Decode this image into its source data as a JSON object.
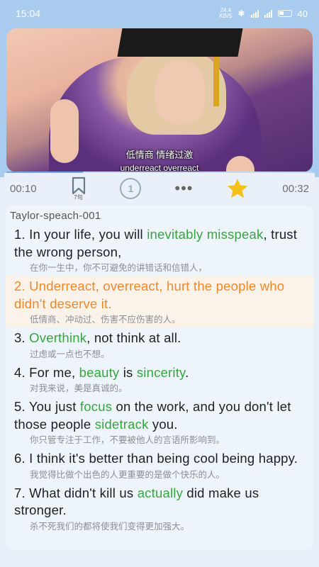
{
  "status": {
    "time": "15:04",
    "speed_value": "24.4",
    "speed_unit": "KB/S",
    "bluetooth": "✱",
    "battery": "40"
  },
  "video": {
    "subtitle_zh": "低情商 情绪过激",
    "subtitle_en": "underreact overreact",
    "progress": 0.25
  },
  "controls": {
    "current_time": "00:10",
    "total_time": "00:32",
    "bookmark_count": "7句",
    "replay_label": "1",
    "more": "•••",
    "favorite_color": "#f3c21a"
  },
  "lesson": {
    "title": "Taylor-speach-001",
    "sentences": [
      {
        "segments": [
          {
            "text": "1. In your life, you will ",
            "kw": false
          },
          {
            "text": "inevitably",
            "kw": true
          },
          {
            "text": " ",
            "kw": false
          },
          {
            "text": "misspeak",
            "kw": true
          },
          {
            "text": ", trust the wrong person,",
            "kw": false
          }
        ],
        "zh": "在你一生中，你不可避免的讲错话和信错人，",
        "active": false
      },
      {
        "segments": [
          {
            "text": "2. Underreact, overreact, hurt the people who didn't deserve it.",
            "kw": false
          }
        ],
        "zh": "低情商、冲动过、伤害不应伤害的人。",
        "active": true
      },
      {
        "segments": [
          {
            "text": "3. ",
            "kw": false
          },
          {
            "text": "Overthink",
            "kw": true
          },
          {
            "text": ", not think at all.",
            "kw": false
          }
        ],
        "zh": "过虑或一点也不想。",
        "active": false
      },
      {
        "segments": [
          {
            "text": "4. For me, ",
            "kw": false
          },
          {
            "text": "beauty",
            "kw": true
          },
          {
            "text": " is ",
            "kw": false
          },
          {
            "text": "sincerity",
            "kw": true
          },
          {
            "text": ".",
            "kw": false
          }
        ],
        "zh": "对我来说，美是真诚的。",
        "active": false
      },
      {
        "segments": [
          {
            "text": "5. You just ",
            "kw": false
          },
          {
            "text": "focus",
            "kw": true
          },
          {
            "text": " on the work, and you don't let those people ",
            "kw": false
          },
          {
            "text": "sidetrack",
            "kw": true
          },
          {
            "text": " you.",
            "kw": false
          }
        ],
        "zh": "你只管专注于工作，不要被他人的言语所影响到。",
        "active": false
      },
      {
        "segments": [
          {
            "text": "6. I think it's better than being cool being happy.",
            "kw": false
          }
        ],
        "zh": "我觉得比做个出色的人更重要的是做个快乐的人。",
        "active": false
      },
      {
        "segments": [
          {
            "text": "7. What didn't kill us ",
            "kw": false
          },
          {
            "text": "actually",
            "kw": true
          },
          {
            "text": " did make us stronger.",
            "kw": false
          }
        ],
        "zh": "杀不死我们的都将使我们变得更加强大。",
        "active": false
      }
    ]
  }
}
